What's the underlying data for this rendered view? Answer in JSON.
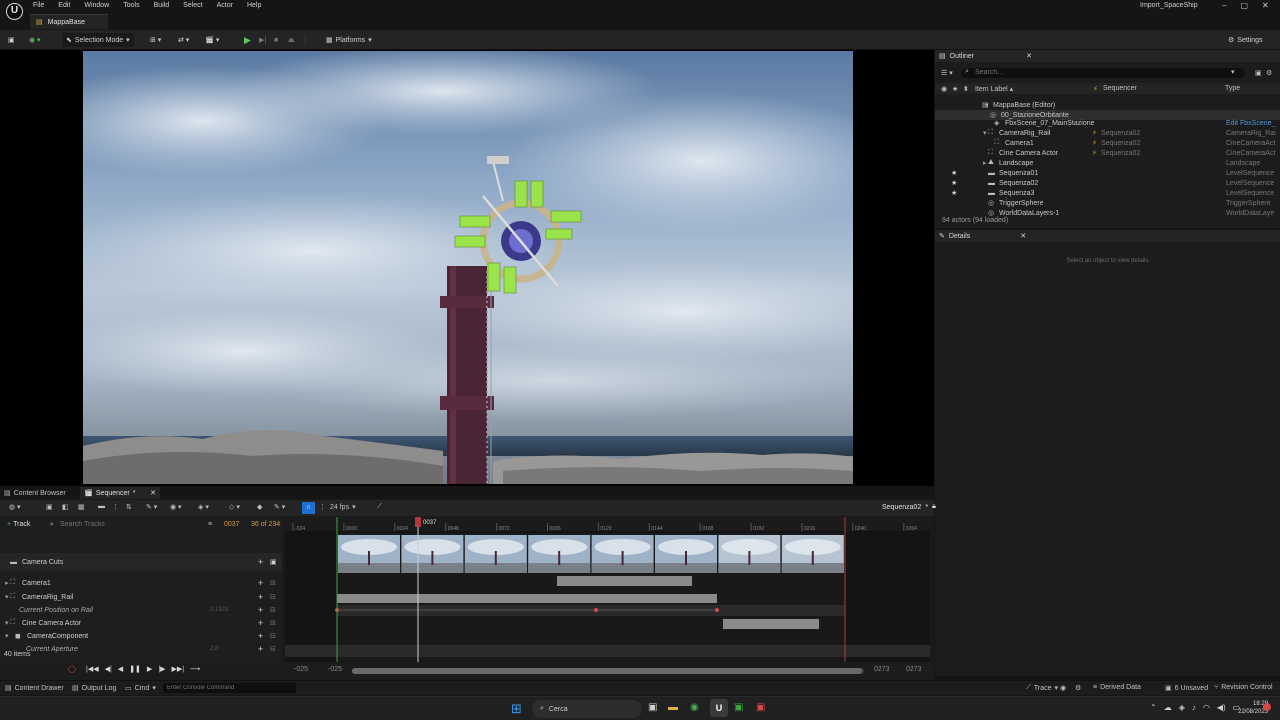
{
  "menubar": {
    "items": [
      "File",
      "Edit",
      "Window",
      "Tools",
      "Build",
      "Select",
      "Actor",
      "Help"
    ],
    "project_title": "Import_SpaceShip",
    "logo_glyph": "U"
  },
  "tabs": {
    "map_tab": "MappaBase"
  },
  "toolbar": {
    "selection_mode": "Selection Mode",
    "platforms": "Platforms",
    "settings": "Settings"
  },
  "outliner": {
    "tab_label": "Outliner",
    "search_placeholder": "Search...",
    "columns": {
      "item_label": "Item Label ▴",
      "sequencer": "Sequencer",
      "type": "Type"
    },
    "rows": [
      {
        "label": "MappaBase (Editor)",
        "sequencer": "",
        "type": ""
      },
      {
        "label": "00_StazioneOrbitante",
        "sequencer": "",
        "type": ""
      },
      {
        "label": "FbxScene_07_MainStazione",
        "sequencer": "",
        "type": "Edit FbxScene_"
      },
      {
        "label": "CameraRig_Rail",
        "sequencer": "Sequenza02",
        "type": "CameraRig_Rai"
      },
      {
        "label": "Camera1",
        "sequencer": "Sequenza02",
        "type": "CineCameraAct"
      },
      {
        "label": "Cine Camera Actor",
        "sequencer": "Sequenza02",
        "type": "CineCameraAct"
      },
      {
        "label": "Landscape",
        "sequencer": "",
        "type": "Landscape"
      },
      {
        "label": "Sequenza01",
        "sequencer": "",
        "type": "LevelSequence"
      },
      {
        "label": "Sequenza02",
        "sequencer": "",
        "type": "LevelSequence"
      },
      {
        "label": "Sequenza3",
        "sequencer": "",
        "type": "LevelSequence"
      },
      {
        "label": "TriggerSphere",
        "sequencer": "",
        "type": "TriggerSphere"
      },
      {
        "label": "WorldDataLayers-1",
        "sequencer": "",
        "type": "WorldDataLaye"
      }
    ],
    "footer": "94 actors (94 loaded)"
  },
  "details": {
    "tab_label": "Details",
    "empty_message": "Select an object to view details"
  },
  "sequencer": {
    "content_browser_tab": "Content Browser",
    "sequencer_tab": "Sequencer",
    "fps": "24 fps",
    "sequence_name": "Sequenza02",
    "add_track": "Track",
    "search_placeholder": "Search Tracks",
    "current_frame": "0037",
    "frame_count": "36 of 234",
    "playhead_label": "0037",
    "ruler_ticks": [
      "-024",
      "0000",
      "0024",
      "0048",
      "0072",
      "0096",
      "0120",
      "0144",
      "0168",
      "0192",
      "0216",
      "0240",
      "0264"
    ],
    "tracks": [
      {
        "label": "Camera Cuts",
        "indent": 0
      },
      {
        "label": "Camera1",
        "indent": 0
      },
      {
        "label": "CameraRig_Rail",
        "indent": 0
      },
      {
        "label": "Current Position on Rail",
        "indent": 2
      },
      {
        "label": "Cine Camera Actor",
        "indent": 0
      },
      {
        "label": "CameraComponent",
        "indent": 1
      },
      {
        "label": "Current Aperture",
        "indent": 2
      }
    ],
    "rail_value": "0.1923",
    "aperture_value": "2.8",
    "item_count": "40 items",
    "range_start": "-025",
    "range_start2": "-025",
    "range_end": "0273",
    "range_end2": "0273"
  },
  "statusbar": {
    "content_drawer": "Content Drawer",
    "output_log": "Output Log",
    "cmd": "Cmd",
    "console_placeholder": "Enter Console Command",
    "trace": "Trace",
    "derived_data": "Derived Data",
    "unsaved": "6 Unsaved",
    "revision_control": "Revision Control"
  },
  "taskbar": {
    "search_label": "Cerca",
    "time": "18:29",
    "date": "22/08/2023"
  },
  "colors": {
    "accent_blue": "#1f6fd1",
    "keyframe_red": "#d44a4a",
    "playhead_red": "#b03a3a",
    "green_marker": "#3aa83a"
  }
}
